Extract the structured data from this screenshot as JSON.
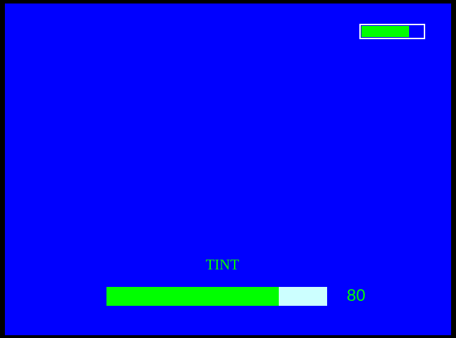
{
  "colors": {
    "background": "#0000ff",
    "frame": "#000000",
    "accent": "#00ff00",
    "track": "#ccffff",
    "outline": "#ffffff"
  },
  "battery": {
    "icon": "battery-icon",
    "level_percent": 78
  },
  "osd": {
    "label": "TINT",
    "value": "80",
    "level_percent": 78
  }
}
